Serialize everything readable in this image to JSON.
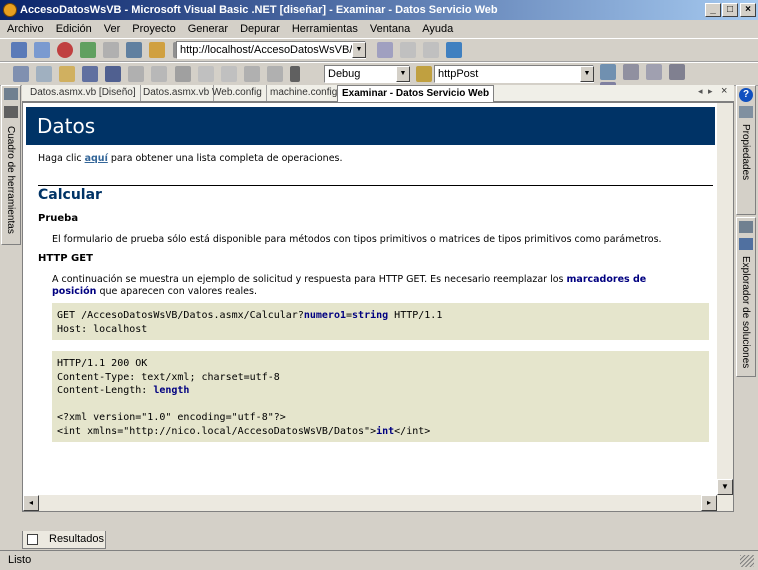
{
  "window": {
    "title": "AccesoDatosWsVB - Microsoft Visual Basic .NET [diseñar] - Examinar - Datos Servicio Web",
    "buttons": [
      "_",
      "□",
      "×"
    ]
  },
  "menu": [
    "Archivo",
    "Edición",
    "Ver",
    "Proyecto",
    "Generar",
    "Depurar",
    "Herramientas",
    "Ventana",
    "Ayuda"
  ],
  "nav_toolbar": {
    "url": "http://localhost/AccesoDatosWsVB/Datos.a"
  },
  "std_toolbar": {
    "config": "Debug",
    "search": "httpPost"
  },
  "left_panel": {
    "label": "Cuadro de herramientas"
  },
  "right_panel": {
    "top_label": "Propiedades",
    "bottom_label": "Explorador de soluciones"
  },
  "tabs": [
    {
      "label": "Datos.asmx.vb [Diseño]"
    },
    {
      "label": "Datos.asmx.vb"
    },
    {
      "label": "Web.config"
    },
    {
      "label": "machine.config"
    },
    {
      "label": "Examinar - Datos Servicio Web"
    }
  ],
  "page": {
    "banner": "Datos",
    "intro_before": "Haga clic ",
    "intro_link": "aquí",
    "intro_after": " para obtener una lista completa de operaciones.",
    "section_title": "Calcular",
    "prueba_heading": "Prueba",
    "prueba_text": "El formulario de prueba sólo está disponible para métodos con tipos primitivos o matrices de tipos primitivos como parámetros.",
    "httpget_heading": "HTTP GET",
    "httpget_text_1": "A continuación se muestra un ejemplo de solicitud y respuesta para HTTP GET. Es necesario reemplazar los ",
    "httpget_text_bold_1": "marcadores de",
    "httpget_text_bold_2": "posición",
    "httpget_text_2": " que aparecen con valores reales.",
    "request": {
      "line1_pre": "GET /AccesoDatosWsVB/Datos.asmx/Calcular?",
      "param_name": "numero1",
      "param_eq": "=",
      "param_value": "string",
      "line1_post": " HTTP/1.1",
      "line2": "Host: localhost"
    },
    "response": {
      "line1": "HTTP/1.1 200 OK",
      "line2": "Content-Type: text/xml; charset=utf-8",
      "line3_pre": "Content-Length: ",
      "line3_val": "length",
      "line5": "<?xml version=\"1.0\" encoding=\"utf-8\"?>",
      "line6_pre": "<int xmlns=\"http://nico.local/AccesoDatosWsVB/Datos\">",
      "line6_val": "int",
      "line6_post": "</int>"
    }
  },
  "results_tab": "Resultados",
  "status": "Listo",
  "colors": {
    "banner": "#003366",
    "code_bg": "#e5e5cc",
    "titlebar": "#0a246a"
  }
}
